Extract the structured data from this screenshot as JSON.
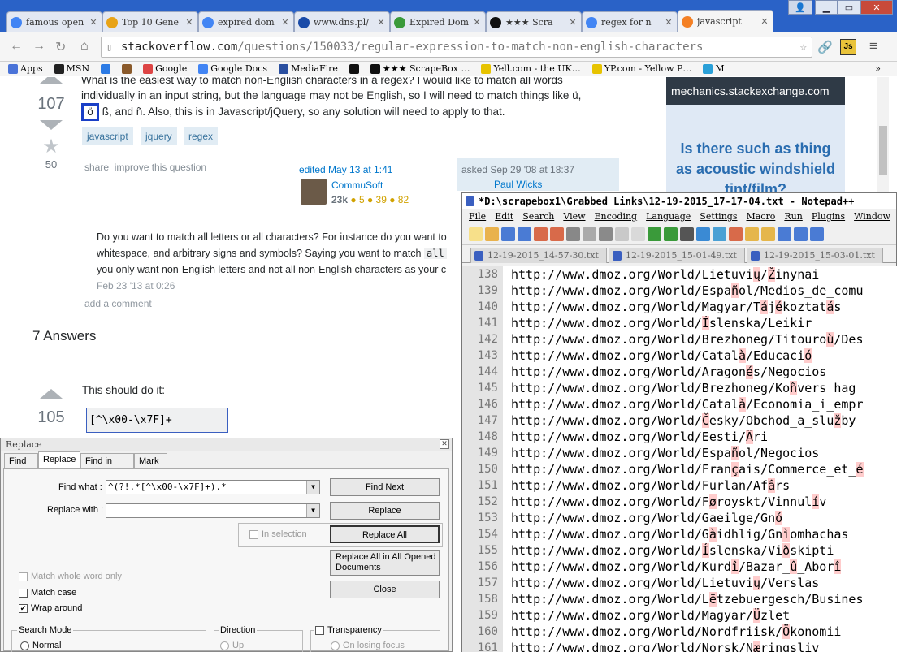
{
  "browser": {
    "tabs": [
      {
        "title": "famous open",
        "icon": "google-icon",
        "color": "#4285f4"
      },
      {
        "title": "Top 10 Gene",
        "icon": "gear-star-icon",
        "color": "#e8a317"
      },
      {
        "title": "expired dom",
        "icon": "google-icon",
        "color": "#4285f4"
      },
      {
        "title": "www.dns.pl/",
        "icon": "dns-icon",
        "color": "#1a4ba8"
      },
      {
        "title": "Expired Dom",
        "icon": "cube-icon",
        "color": "#3a9a3a"
      },
      {
        "title": "★★★ Scra",
        "icon": "scrapebox-icon",
        "color": "#111111"
      },
      {
        "title": "regex for n",
        "icon": "google-icon",
        "color": "#4285f4"
      },
      {
        "title": "javascript",
        "icon": "stackoverflow-icon",
        "color": "#f48024"
      }
    ],
    "url_domain": "stackoverflow.com",
    "url_path": "/questions/150033/regular-expression-to-match-non-english-characters",
    "bookmarks": [
      "Apps",
      "MSN",
      "",
      "",
      "Google",
      "Google Docs",
      "MediaFire",
      "",
      "★★★ ScrapeBox …",
      "Yell.com - the UK…",
      "YP.com - Yellow P…",
      "M"
    ],
    "bookmark_more": "»"
  },
  "question": {
    "text_line0": "What is the easiest way to match non-English characters in a regex? I would like to match all words",
    "text_line1": "individually in an input string, but the language may not be English, so I will need to match things like ü,",
    "text_line2a": "ö",
    "text_line2b": " ß, and ñ. Also, this is in Javascript/jQuery, so any solution will need to apply to that.",
    "votes": "107",
    "favorites": "50",
    "tags": [
      "javascript",
      "jquery",
      "regex"
    ],
    "share": "share",
    "improve": "improve this question",
    "edited": "edited May 13 at 1:41",
    "editor": "CommuSoft",
    "editor_rep": "23k",
    "editor_badges": "● 5  ● 39  ● 82",
    "asked": "asked Sep 29 '08 at 18:37",
    "asker": "Paul Wicks"
  },
  "comment": {
    "line1": "Do you want to match all letters or all characters? For instance do you want to",
    "line2a": "whitespace, and arbitrary signs and symbols? Saying you want to match ",
    "line2b": "all",
    "line3": "you only want non-English letters and not all non-English characters as your c",
    "date": "Feb 23 '13 at 0:26",
    "add": "add a comment"
  },
  "answers": {
    "heading": "7 Answers",
    "first_text": "This should do it:",
    "first_votes": "105",
    "first_code": "[^\\x00-\\x7F]+"
  },
  "sidebar": {
    "site": "mechanics.stackexchange.com",
    "ad_text": "Is there such as thing as acoustic windshield tint/film?"
  },
  "npp": {
    "title": "*D:\\scrapebox1\\Grabbed Links\\12-19-2015_17-17-04.txt - Notepad++",
    "menu": [
      "File",
      "Edit",
      "Search",
      "View",
      "Encoding",
      "Language",
      "Settings",
      "Macro",
      "Run",
      "Plugins",
      "Window",
      "?"
    ],
    "doc_tabs": [
      "12-19-2015_14-57-30.txt",
      "12-19-2015_15-01-49.txt",
      "12-19-2015_15-03-01.txt"
    ],
    "lines": [
      {
        "n": "138",
        "segs": [
          [
            "http://www.dmoz.org/World/Lietuvi",
            0
          ],
          [
            "ų",
            1
          ],
          [
            "/",
            0
          ],
          [
            "Ž",
            1
          ],
          [
            "inynai",
            0
          ]
        ]
      },
      {
        "n": "139",
        "segs": [
          [
            "http://www.dmoz.org/World/Espa",
            0
          ],
          [
            "ñ",
            1
          ],
          [
            "ol/Medios_de_comu",
            0
          ]
        ]
      },
      {
        "n": "140",
        "segs": [
          [
            "http://www.dmoz.org/World/Magyar/T",
            0
          ],
          [
            "á",
            1
          ],
          [
            "j",
            0
          ],
          [
            "é",
            1
          ],
          [
            "koztat",
            0
          ],
          [
            "á",
            1
          ],
          [
            "s",
            0
          ]
        ]
      },
      {
        "n": "141",
        "segs": [
          [
            "http://www.dmoz.org/World/",
            0
          ],
          [
            "Í",
            1
          ],
          [
            "slenska/Leikir",
            0
          ]
        ]
      },
      {
        "n": "142",
        "segs": [
          [
            "http://www.dmoz.org/World/Brezhoneg/Titouro",
            0
          ],
          [
            "ù",
            1
          ],
          [
            "/Des",
            0
          ]
        ]
      },
      {
        "n": "143",
        "segs": [
          [
            "http://www.dmoz.org/World/Catal",
            0
          ],
          [
            "à",
            1
          ],
          [
            "/Educaci",
            0
          ],
          [
            "ó",
            1
          ]
        ]
      },
      {
        "n": "144",
        "segs": [
          [
            "http://www.dmoz.org/World/Aragon",
            0
          ],
          [
            "é",
            1
          ],
          [
            "s/Negocios",
            0
          ]
        ]
      },
      {
        "n": "145",
        "segs": [
          [
            "http://www.dmoz.org/World/Brezhoneg/Ko",
            0
          ],
          [
            "ñ",
            1
          ],
          [
            "vers_hag_",
            0
          ]
        ]
      },
      {
        "n": "146",
        "segs": [
          [
            "http://www.dmoz.org/World/Catal",
            0
          ],
          [
            "à",
            1
          ],
          [
            "/Economia_i_empr",
            0
          ]
        ]
      },
      {
        "n": "147",
        "segs": [
          [
            "http://www.dmoz.org/World/",
            0
          ],
          [
            "Č",
            1
          ],
          [
            "esky/Obchod_a_slu",
            0
          ],
          [
            "ž",
            1
          ],
          [
            "by",
            0
          ]
        ]
      },
      {
        "n": "148",
        "segs": [
          [
            "http://www.dmoz.org/World/Eesti/",
            0
          ],
          [
            "Ä",
            1
          ],
          [
            "ri",
            0
          ]
        ]
      },
      {
        "n": "149",
        "segs": [
          [
            "http://www.dmoz.org/World/Espa",
            0
          ],
          [
            "ñ",
            1
          ],
          [
            "ol/Negocios",
            0
          ]
        ]
      },
      {
        "n": "150",
        "segs": [
          [
            "http://www.dmoz.org/World/Fran",
            0
          ],
          [
            "ç",
            1
          ],
          [
            "ais/Commerce_et_",
            0
          ],
          [
            "é",
            1
          ]
        ]
      },
      {
        "n": "151",
        "segs": [
          [
            "http://www.dmoz.org/World/Furlan/Af",
            0
          ],
          [
            "â",
            1
          ],
          [
            "rs",
            0
          ]
        ]
      },
      {
        "n": "152",
        "segs": [
          [
            "http://www.dmoz.org/World/F",
            0
          ],
          [
            "ø",
            1
          ],
          [
            "roysk",
            0
          ],
          [
            "t",
            0
          ],
          [
            "/Vinnul",
            0
          ],
          [
            "í",
            1
          ],
          [
            "v",
            0
          ]
        ]
      },
      {
        "n": "153",
        "segs": [
          [
            "http://www.dmoz.org/World/Gaeilge/Gn",
            0
          ],
          [
            "ó",
            1
          ]
        ]
      },
      {
        "n": "154",
        "segs": [
          [
            "http://www.dmoz.org/World/G",
            0
          ],
          [
            "à",
            1
          ],
          [
            "idhlig/Gn",
            0
          ],
          [
            "ì",
            1
          ],
          [
            "omhachas",
            0
          ]
        ]
      },
      {
        "n": "155",
        "segs": [
          [
            "http://www.dmoz.org/World/",
            0
          ],
          [
            "Í",
            1
          ],
          [
            "slenska/Vi",
            0
          ],
          [
            "ð",
            1
          ],
          [
            "skipti",
            0
          ]
        ]
      },
      {
        "n": "156",
        "segs": [
          [
            "http://www.dmoz.org/World/Kurd",
            0
          ],
          [
            "î",
            1
          ],
          [
            "/Bazar_",
            0
          ],
          [
            "û",
            1
          ],
          [
            "_Abor",
            0
          ],
          [
            "î",
            1
          ]
        ]
      },
      {
        "n": "157",
        "segs": [
          [
            "http://www.dmoz.org/World/Lietuvi",
            0
          ],
          [
            "ų",
            1
          ],
          [
            "/Verslas",
            0
          ]
        ]
      },
      {
        "n": "158",
        "segs": [
          [
            "http://www.dmoz.org/World/L",
            0
          ],
          [
            "ë",
            1
          ],
          [
            "tzebuergesch/Busines",
            0
          ]
        ]
      },
      {
        "n": "159",
        "segs": [
          [
            "http://www.dmoz.org/World/Magyar/",
            0
          ],
          [
            "Ü",
            1
          ],
          [
            "zlet",
            0
          ]
        ]
      },
      {
        "n": "160",
        "segs": [
          [
            "http://www.dmoz.org/World/Nordfriisk/",
            0
          ],
          [
            "Ö",
            1
          ],
          [
            "konomii",
            0
          ]
        ]
      },
      {
        "n": "161",
        "segs": [
          [
            "http://www.dmoz.org/World/Norsk/N",
            0
          ],
          [
            "æ",
            1
          ],
          [
            "ringsliv",
            0
          ]
        ]
      }
    ]
  },
  "dialog": {
    "title": "Replace",
    "tabs": [
      "Find",
      "Replace",
      "Find in Files",
      "Mark"
    ],
    "find_label": "Find what :",
    "find_value": "^(?!.*[^\\x00-\\x7F]+).*",
    "replace_label": "Replace with :",
    "replace_value": "",
    "find_next": "Find Next",
    "replace": "Replace",
    "replace_all": "Replace All",
    "replace_all_docs": "Replace All in All Opened Documents",
    "close": "Close",
    "in_selection": "In selection",
    "match_whole": "Match whole word only",
    "match_case": "Match case",
    "wrap_around": "Wrap around",
    "search_mode": "Search Mode",
    "normal": "Normal",
    "direction": "Direction",
    "up": "Up",
    "transparency": "Transparency",
    "on_losing_focus": "On losing focus"
  }
}
